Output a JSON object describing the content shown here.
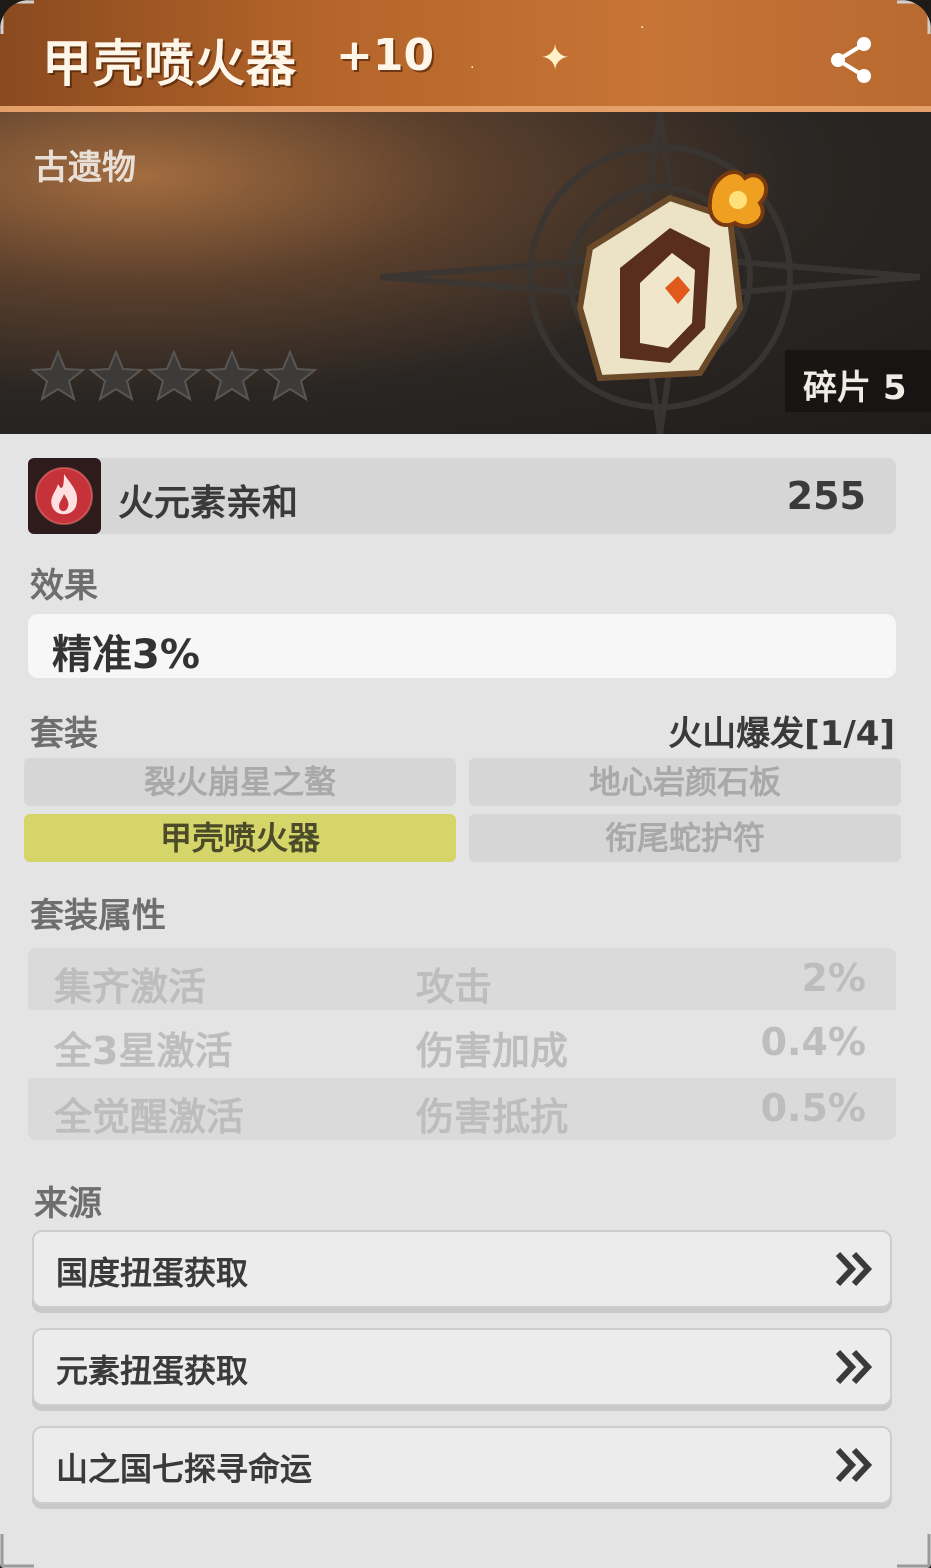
{
  "header": {
    "title": "甲壳喷火器",
    "level": "+10",
    "share_icon": "share-icon"
  },
  "banner": {
    "type_label": "古遗物",
    "rarity_stars": 5,
    "fragment_label": "碎片 5"
  },
  "main_stat": {
    "icon": "fire-element-icon",
    "label": "火元素亲和",
    "value": "255"
  },
  "effect": {
    "heading": "效果",
    "value": "精准3%"
  },
  "set": {
    "heading": "套装",
    "name": "火山爆发[1/4]",
    "pieces": [
      {
        "label": "裂火崩星之螯",
        "active": false
      },
      {
        "label": "地心岩颜石板",
        "active": false
      },
      {
        "label": "甲壳喷火器",
        "active": true
      },
      {
        "label": "衔尾蛇护符",
        "active": false
      }
    ]
  },
  "set_attributes": {
    "heading": "套装属性",
    "rows": [
      {
        "condition": "集齐激活",
        "stat": "攻击",
        "value": "2%"
      },
      {
        "condition": "全3星激活",
        "stat": "伤害加成",
        "value": "0.4%"
      },
      {
        "condition": "全觉醒激活",
        "stat": "伤害抵抗",
        "value": "0.5%"
      }
    ]
  },
  "sources": {
    "heading": "来源",
    "items": [
      {
        "label": "国度扭蛋获取",
        "icon": "double-chevron-right-icon"
      },
      {
        "label": "元素扭蛋获取",
        "icon": "double-chevron-right-icon"
      },
      {
        "label": "山之国七探寻命运",
        "icon": "double-chevron-right-icon"
      }
    ]
  },
  "colors": {
    "header_orange": "#c77436",
    "active_set_piece": "#d5d56a",
    "panel_bg": "#e4e4e4"
  }
}
